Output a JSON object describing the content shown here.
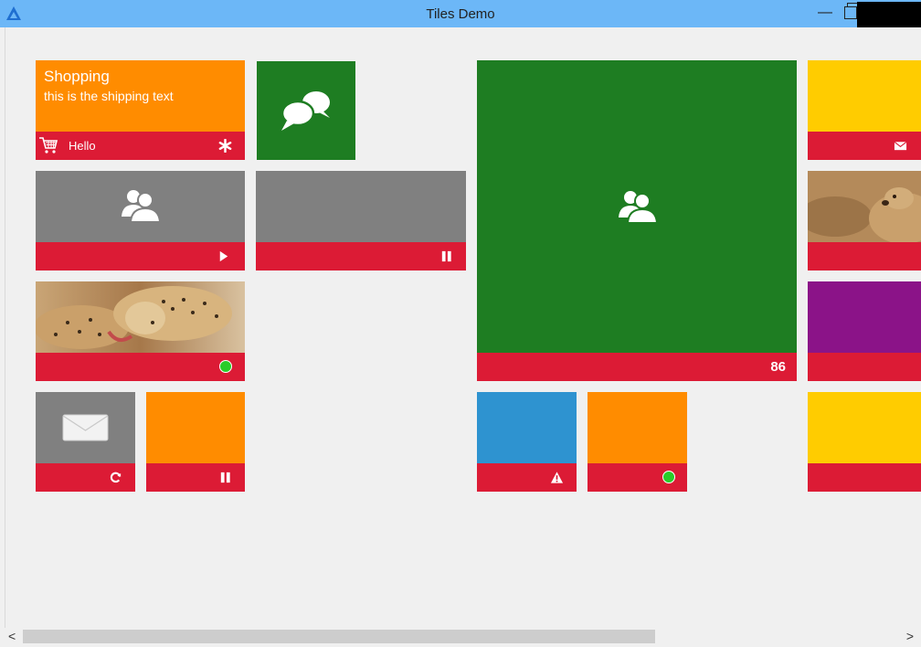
{
  "window": {
    "title": "Tiles Demo",
    "minimize_glyph": "—"
  },
  "tiles": {
    "shopping": {
      "title": "Shopping",
      "subtitle": "this is the shipping text",
      "bar_text": "Hello",
      "icon": "asterisk-icon",
      "bar_left_icon": "cart-icon"
    },
    "chat": {
      "icon": "speech-bubbles-icon"
    },
    "people": {
      "icon": "people-icon",
      "bar_icon": "play-icon"
    },
    "gray_pause": {
      "bar_icon": "pause-icon"
    },
    "cheetah": {
      "image": "cheetah-photo",
      "bar_icon": "status-dot-icon"
    },
    "mail": {
      "icon": "mail-icon",
      "bar_icon": "refresh-icon"
    },
    "orange_pause": {
      "bar_icon": "pause-icon"
    },
    "big_green": {
      "icon": "people-icon",
      "count": "86"
    },
    "blue": {
      "bar_icon": "warning-icon"
    },
    "orange_dot": {
      "bar_icon": "status-dot-icon"
    },
    "yellow_mail": {
      "bar_icon": "envelope-icon"
    },
    "prairie_dog": {
      "image": "prairie-dog-photo"
    },
    "purple": {},
    "yellow2": {}
  },
  "colors": {
    "titlebar": "#6cb7f7",
    "orange": "#ff8c00",
    "green": "#1e7d22",
    "gray": "#808080",
    "red_bar": "#dc1b35",
    "blue": "#2e93d0",
    "yellow": "#ffcc00",
    "purple": "#8b1388",
    "status_green": "#29cc29"
  },
  "scrollbar": {
    "left_glyph": "<",
    "right_glyph": ">"
  }
}
